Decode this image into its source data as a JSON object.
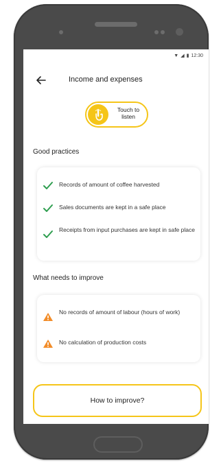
{
  "status_bar": {
    "time": "12:30",
    "icons": [
      "wifi-icon",
      "signal-icon",
      "battery-icon"
    ]
  },
  "header": {
    "back_icon": "arrow-left-icon",
    "title": "Income and expenses"
  },
  "listen_button": {
    "icon": "hand-touch-icon",
    "label": "Touch to listen"
  },
  "good_practices": {
    "title": "Good practices",
    "icon": "check-icon",
    "items": [
      "Records of amount of coffee harvested",
      "Sales documents are kept in a safe place",
      "Receipts from input purchases are kept in safe place"
    ]
  },
  "needs_improve": {
    "title": "What needs to improve",
    "icon": "warning-triangle-icon",
    "items": [
      "No records of amount of labour (hours of work)",
      "No calculation of production costs"
    ]
  },
  "improve_button": {
    "label": "How to improve?"
  },
  "colors": {
    "accent": "#f5c518",
    "check": "#2e9e4f",
    "warning": "#f28c28",
    "phone_body": "#4a4a4a"
  }
}
